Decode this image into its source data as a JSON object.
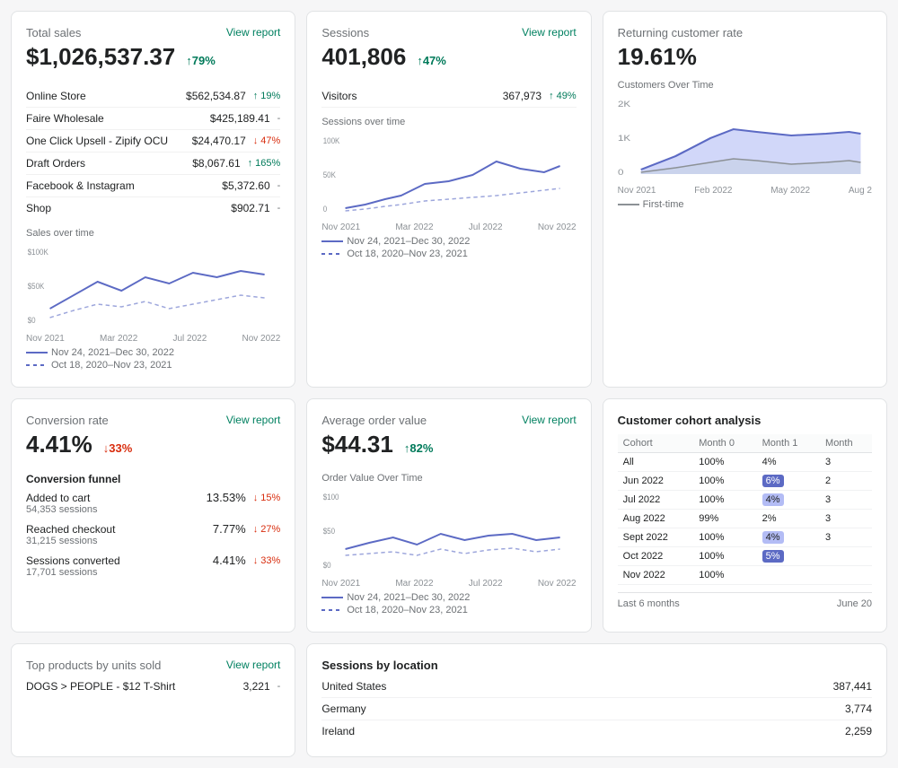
{
  "totalSales": {
    "title": "Total sales",
    "viewReport": "View report",
    "value": "$1,026,537.37",
    "change": "↑79%",
    "changeType": "up",
    "rows": [
      {
        "label": "Online Store",
        "value": "$562,534.87",
        "change": "↑ 19%",
        "changeType": "up"
      },
      {
        "label": "Faire Wholesale",
        "value": "$425,189.41",
        "change": "-",
        "changeType": "neutral"
      },
      {
        "label": "One Click Upsell - Zipify OCU",
        "value": "$24,470.17",
        "change": "↓ 47%",
        "changeType": "down"
      },
      {
        "label": "Draft Orders",
        "value": "$8,067.61",
        "change": "↑ 165%",
        "changeType": "up"
      },
      {
        "label": "Facebook & Instagram",
        "value": "$5,372.60",
        "change": "-",
        "changeType": "neutral"
      },
      {
        "label": "Shop",
        "value": "$902.71",
        "change": "-",
        "changeType": "neutral"
      }
    ],
    "chartTitle": "Sales over time",
    "yLabels": [
      "$100K",
      "$50K",
      "$0"
    ],
    "xLabels": [
      "Nov 2021",
      "Mar 2022",
      "Jul 2022",
      "Nov 2022"
    ],
    "legend1": "Nov 24, 2021–Dec 30, 2022",
    "legend2": "Oct 18, 2020–Nov 23, 2021"
  },
  "sessions": {
    "title": "Sessions",
    "viewReport": "View report",
    "value": "401,806",
    "change": "↑47%",
    "changeType": "up",
    "visitors": {
      "label": "Visitors",
      "value": "367,973",
      "change": "↑ 49%",
      "changeType": "up"
    },
    "chartTitle": "Sessions over time",
    "yLabels": [
      "100K",
      "50K",
      "0"
    ],
    "xLabels": [
      "Nov 2021",
      "Mar 2022",
      "Jul 2022",
      "Nov 2022"
    ],
    "legend1": "Nov 24, 2021–Dec 30, 2022",
    "legend2": "Oct 18, 2020–Nov 23, 2021"
  },
  "avgOrderValue": {
    "title": "Average order value",
    "viewReport": "View report",
    "value": "$44.31",
    "change": "↑82%",
    "changeType": "up",
    "chartTitle": "Order Value Over Time",
    "yLabels": [
      "$100",
      "$50",
      "$0"
    ],
    "xLabels": [
      "Nov 2021",
      "Mar 2022",
      "Jul 2022",
      "Nov 2022"
    ],
    "legend1": "Nov 24, 2021–Dec 30, 2022",
    "legend2": "Oct 18, 2020–Nov 23, 2021"
  },
  "conversionRate": {
    "title": "Conversion rate",
    "viewReport": "View report",
    "value": "4.41%",
    "change": "↓33%",
    "changeType": "down",
    "funnelTitle": "Conversion funnel",
    "rows": [
      {
        "label": "Added to cart",
        "sessions": "54,353 sessions",
        "value": "13.53%",
        "change": "↓ 15%",
        "changeType": "down"
      },
      {
        "label": "Reached checkout",
        "sessions": "31,215 sessions",
        "value": "7.77%",
        "change": "↓ 27%",
        "changeType": "down"
      },
      {
        "label": "Sessions converted",
        "sessions": "17,701 sessions",
        "value": "4.41%",
        "change": "↓ 33%",
        "changeType": "down"
      }
    ]
  },
  "topProducts": {
    "title": "Top products by units sold",
    "viewReport": "View report",
    "rows": [
      {
        "label": "DOGS > PEOPLE - $12 T-Shirt",
        "value": "3,221",
        "change": "-",
        "changeType": "neutral"
      }
    ]
  },
  "returningCustomer": {
    "title": "Returning customer rate",
    "value": "19.61%",
    "chartTitle": "Customers Over Time",
    "yLabels": [
      "2K",
      "1K",
      "0"
    ],
    "xLabels": [
      "Nov 2021",
      "Feb 2022",
      "May 2022",
      "Aug 2"
    ],
    "legendFirstTime": "First-time"
  },
  "cohortAnalysis": {
    "title": "Customer cohort analysis",
    "headers": [
      "Cohort",
      "Month 0",
      "Month 1",
      "Month"
    ],
    "rows": [
      {
        "cohort": "All",
        "m0": "100%",
        "m1": "4%",
        "m2": "3"
      },
      {
        "cohort": "Jun 2022",
        "m0": "100%",
        "m1": "6%",
        "m2": "2",
        "m1Highlight": "blue"
      },
      {
        "cohort": "Jul 2022",
        "m0": "100%",
        "m1": "4%",
        "m2": "3",
        "m1Highlight": "light"
      },
      {
        "cohort": "Aug 2022",
        "m0": "99%",
        "m1": "2%",
        "m2": "3"
      },
      {
        "cohort": "Sept 2022",
        "m0": "100%",
        "m1": "4%",
        "m2": "3",
        "m1Highlight": "light"
      },
      {
        "cohort": "Oct 2022",
        "m0": "100%",
        "m1": "5%",
        "m2": "",
        "m1Highlight": "blue"
      },
      {
        "cohort": "Nov 2022",
        "m0": "100%",
        "m1": "",
        "m2": ""
      }
    ],
    "lastMonths": "Last 6 months",
    "juneLabel": "June 20"
  },
  "sessionsByLocation": {
    "title": "Sessions by location",
    "rows": [
      {
        "label": "United States",
        "value": "387,441"
      },
      {
        "label": "Germany",
        "value": "3,774"
      },
      {
        "label": "Ireland",
        "value": "2,259"
      }
    ]
  }
}
